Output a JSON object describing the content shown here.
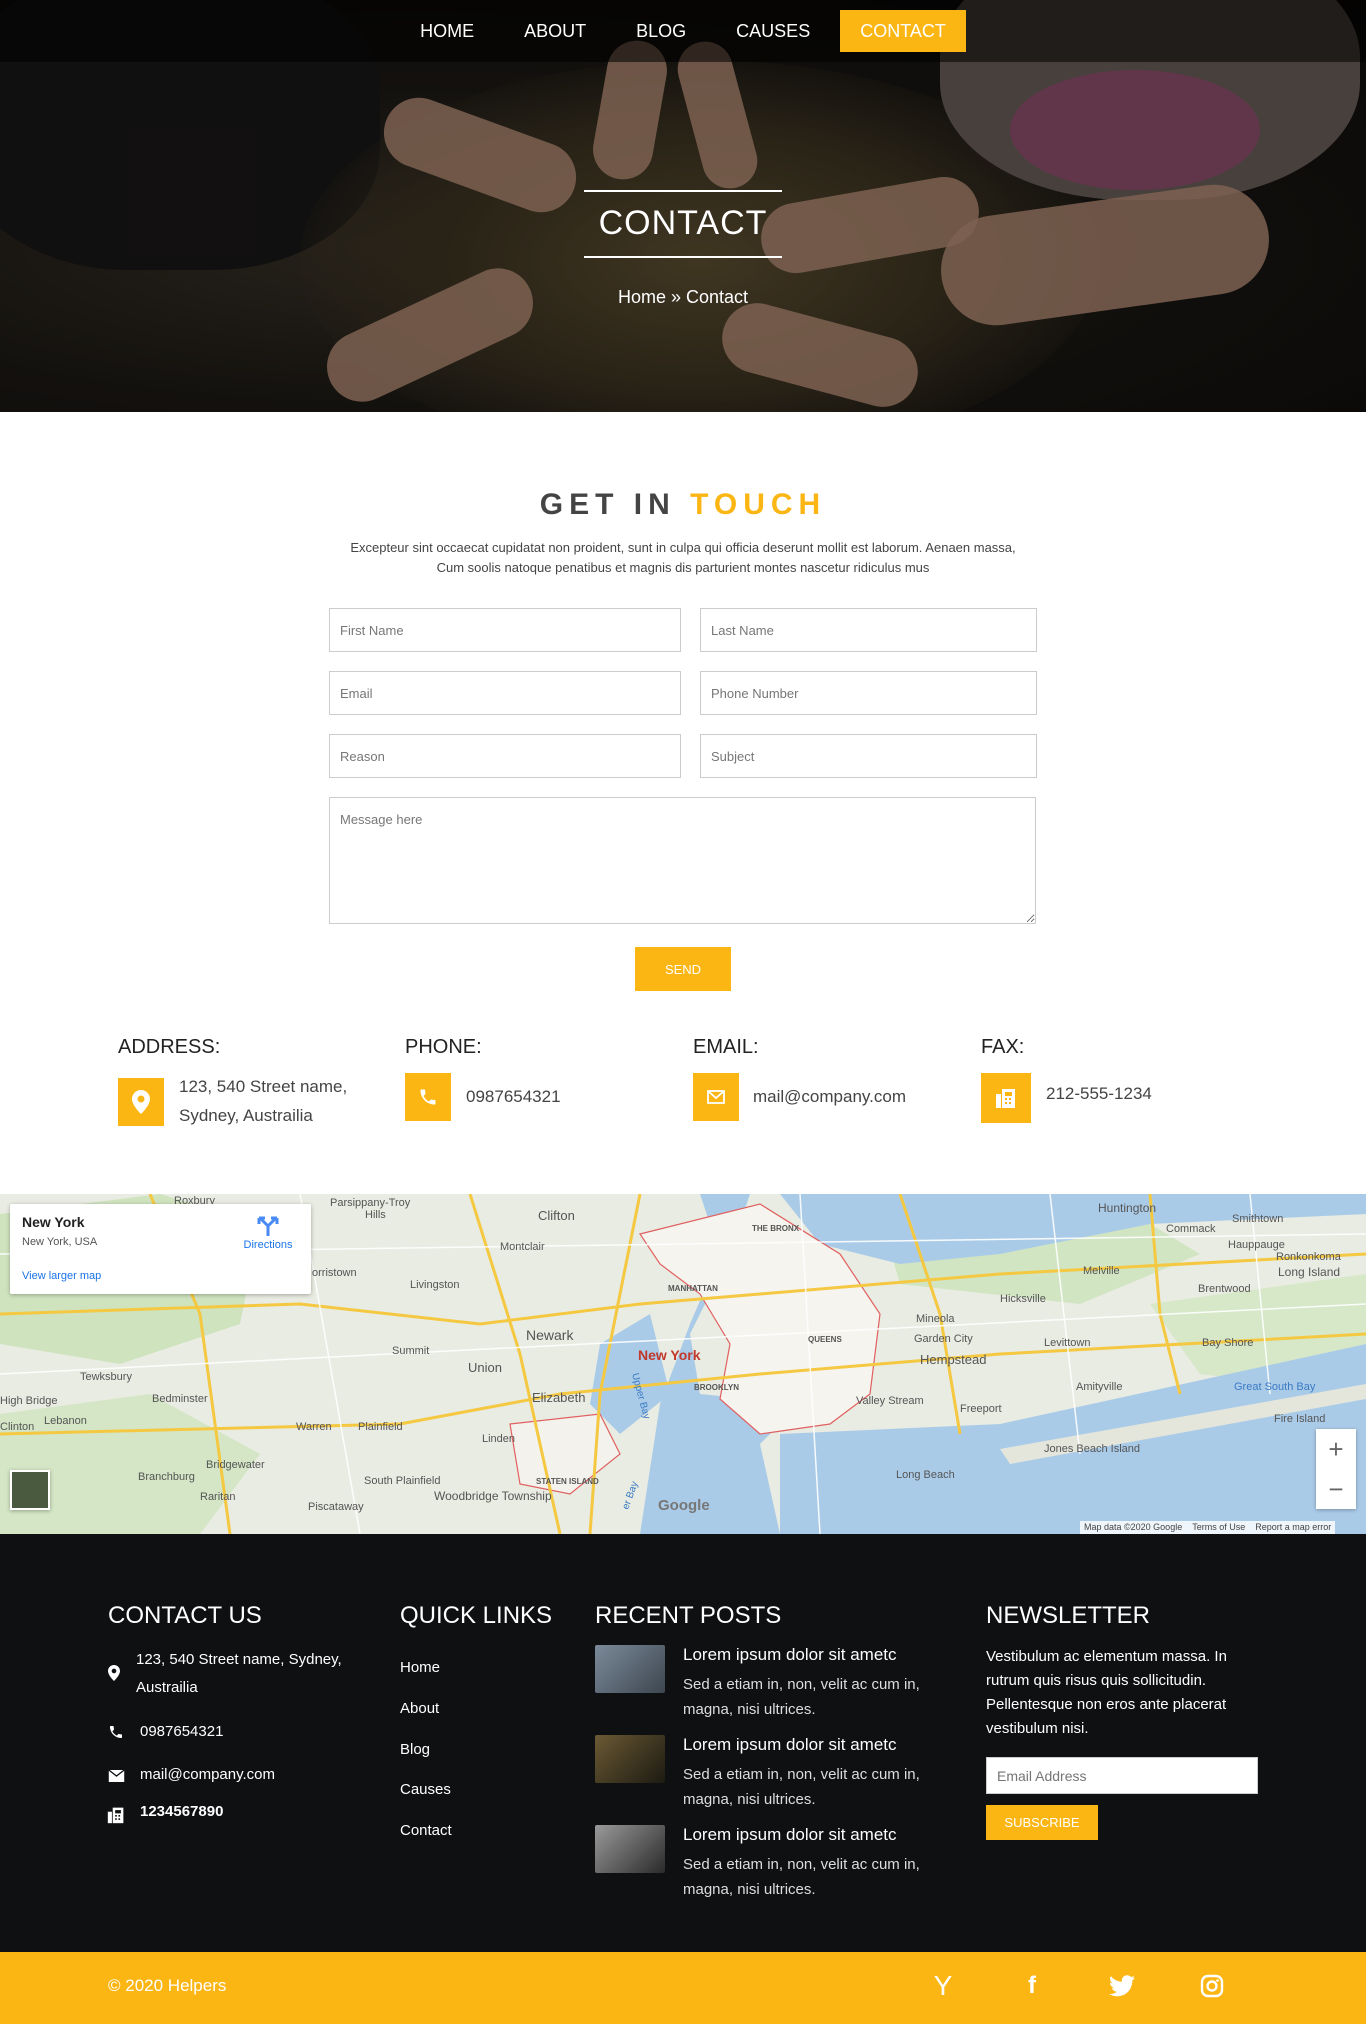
{
  "nav": {
    "items": [
      {
        "label": "HOME"
      },
      {
        "label": "ABOUT"
      },
      {
        "label": "BLOG"
      },
      {
        "label": "CAUSES"
      },
      {
        "label": "CONTACT"
      }
    ],
    "active_index": 4
  },
  "hero": {
    "title": "CONTACT",
    "breadcrumb": "Home » Contact"
  },
  "get_in_touch": {
    "title_part1": "GET IN ",
    "title_part2": "TOUCH",
    "description_line1": "Excepteur sint occaecat cupidatat non proident, sunt in culpa qui officia deserunt mollit est laborum. Aenaen massa,",
    "description_line2": "Cum soolis natoque penatibus et magnis dis parturient montes nascetur ridiculus mus"
  },
  "form": {
    "first_name_placeholder": "First Name",
    "last_name_placeholder": "Last Name",
    "email_placeholder": "Email",
    "phone_placeholder": "Phone Number",
    "reason_placeholder": "Reason",
    "subject_placeholder": "Subject",
    "message_placeholder": "Message here",
    "send_label": "SEND"
  },
  "contact_info": {
    "address_label": "ADDRESS:",
    "address_line1": "123, 540 Street name,",
    "address_line2": "Sydney, Austrailia",
    "phone_label": "PHONE:",
    "phone_value": "0987654321",
    "email_label": "EMAIL:",
    "email_value": "mail@company.com",
    "fax_label": "FAX:",
    "fax_value": "212-555-1234"
  },
  "map": {
    "card_title": "New York",
    "card_subtitle": "New York, USA",
    "directions_label": "Directions",
    "larger_map_label": "View larger map",
    "city_label": "New York",
    "places": {
      "roxbury": "Roxbury",
      "parsippany": "Parsippany-Troy",
      "hills": "Hills",
      "clifton": "Clifton",
      "bronx": "THE BRONX",
      "huntington": "Huntington",
      "smithtown": "Smithtown",
      "commack": "Commack",
      "hauppauge": "Hauppauge",
      "ronkonkoma": "Ronkonkoma",
      "long_island": "Long Island",
      "montclair": "Montclair",
      "livingston": "Livingston",
      "morristown": "orristown",
      "manhattan": "MANHATTAN",
      "melville": "Melville",
      "hicksville": "Hicksville",
      "brentwood": "Brentwood",
      "newark": "Newark",
      "summit": "Summit",
      "union": "Union",
      "mineola": "Mineola",
      "queens": "QUEENS",
      "garden_city": "Garden City",
      "hempstead": "Hempstead",
      "levittown": "Levittown",
      "bay_shore": "Bay Shore",
      "tewksbury": "Tewksbury",
      "bedminster": "Bedminster",
      "elizabeth": "Elizabeth",
      "brooklyn": "BROOKLYN",
      "valley_stream": "Valley Stream",
      "freeport": "Freeport",
      "amityville": "Amityville",
      "great_south_bay": "Great South Bay",
      "high_bridge": "High Bridge",
      "lebanon": "Lebanon",
      "clinton": "Clinton",
      "warren": "Warren",
      "plainfield": "Plainfield",
      "linden": "Linden",
      "fire_island": "Fire Island",
      "bridgewater": "Bridgewater",
      "branchburg": "Branchburg",
      "raritan": "Raritan",
      "south_plainfield": "South Plainfield",
      "staten_island": "STATEN ISLAND",
      "woodbridge": "Woodbridge Township",
      "jones_beach": "Jones Beach Island",
      "long_beach": "Long Beach",
      "piscataway": "Piscataway",
      "upper_bay": "Upper Bay",
      "lower_bay": "er Bay"
    },
    "google_label": "Google",
    "attribution": [
      "Map data ©2020 Google",
      "Terms of Use",
      "Report a map error"
    ],
    "zoom_in": "+",
    "zoom_out": "−"
  },
  "footer": {
    "contact": {
      "heading": "CONTACT US",
      "address_line1": "123, 540 Street name, Sydney,",
      "address_line2": "Austrailia",
      "phone": "0987654321",
      "email": "mail@company.com",
      "fax": "1234567890"
    },
    "quick_links": {
      "heading": "QUICK LINKS",
      "items": [
        "Home",
        "About",
        "Blog",
        "Causes",
        "Contact"
      ]
    },
    "recent_posts": {
      "heading": "RECENT POSTS",
      "items": [
        {
          "title": "Lorem ipsum dolor sit ametc",
          "body_line1": "Sed a etiam in, non, velit ac cum in,",
          "body_line2": "magna, nisi ultrices."
        },
        {
          "title": "Lorem ipsum dolor sit ametc",
          "body_line1": "Sed a etiam in, non, velit ac cum in,",
          "body_line2": "magna, nisi ultrices."
        },
        {
          "title": "Lorem ipsum dolor sit ametc",
          "body_line1": "Sed a etiam in, non, velit ac cum in,",
          "body_line2": "magna, nisi ultrices."
        }
      ]
    },
    "newsletter": {
      "heading": "NEWSLETTER",
      "line1": "Vestibulum ac elementum massa. In",
      "line2": "rutrum quis risus quis sollicitudin.",
      "line3": "Pellentesque non eros ante placerat",
      "line4": "vestibulum nisi.",
      "email_placeholder": "Email Address",
      "subscribe_label": "SUBSCRIBE"
    },
    "copyright": "© 2020 Helpers",
    "social": [
      "Y",
      "f",
      "twitter",
      "instagram"
    ]
  },
  "colors": {
    "accent": "#fbb614",
    "footer_bg": "#0e1012"
  }
}
